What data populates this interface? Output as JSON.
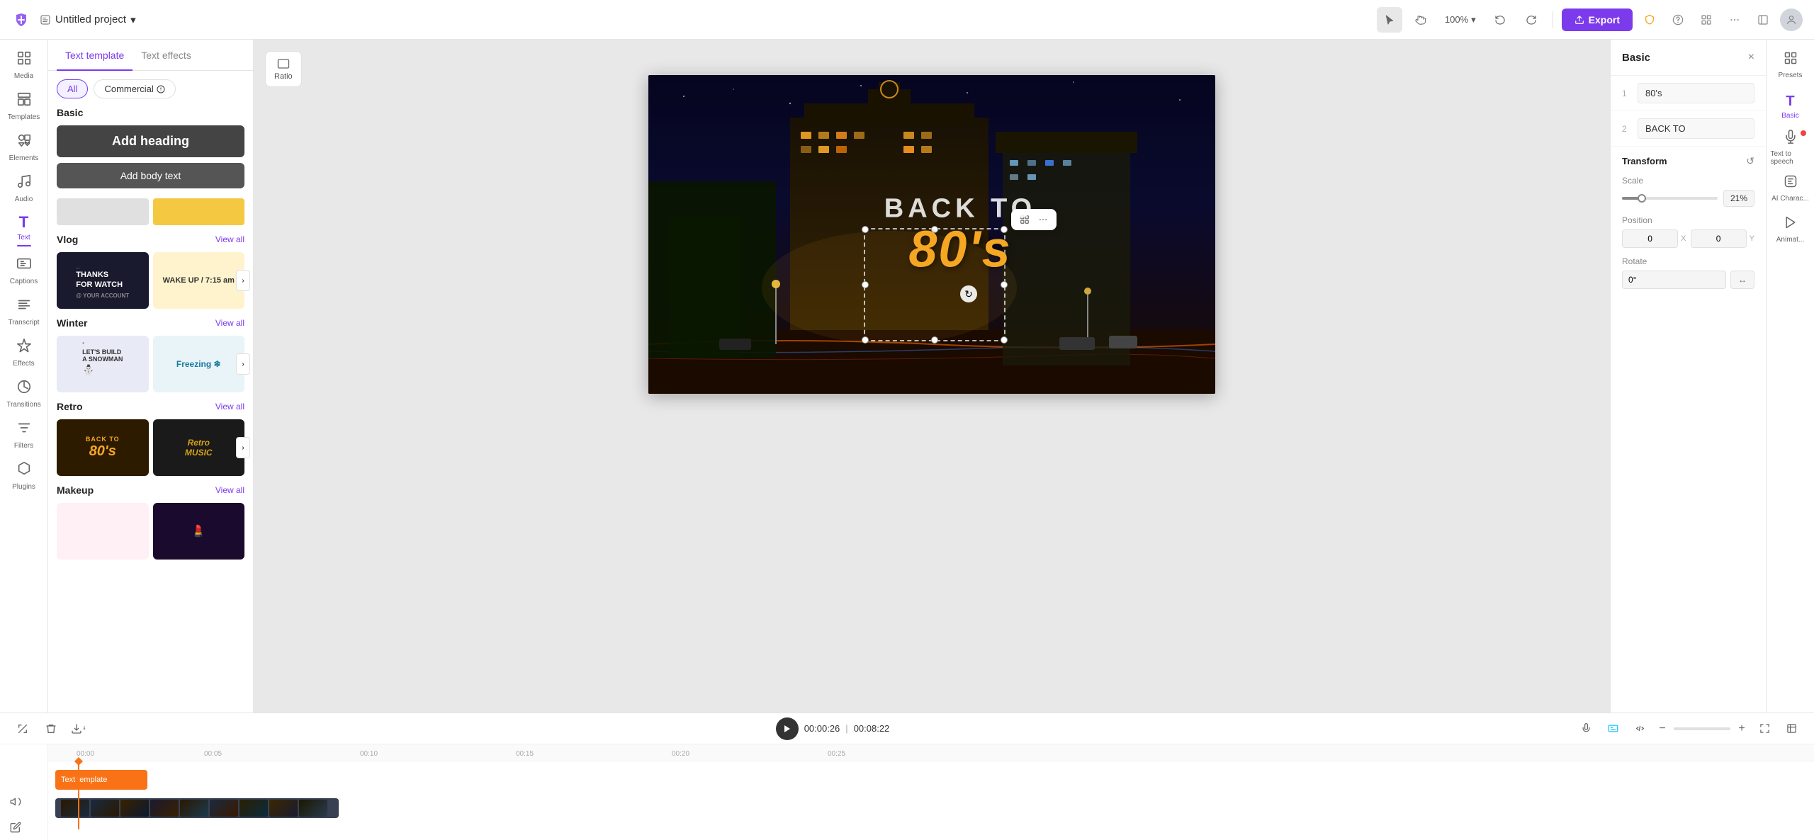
{
  "topbar": {
    "project_name": "Untitled project",
    "zoom_level": "100%",
    "export_label": "Export",
    "undo_icon": "↩",
    "redo_icon": "↪"
  },
  "left_panel": {
    "tab_template": "Text template",
    "tab_effects": "Text effects",
    "filter_all": "All",
    "filter_commercial": "Commercial",
    "add_heading_label": "Add heading",
    "add_body_label": "Add body text",
    "sections": [
      {
        "id": "basic",
        "title": "Basic"
      },
      {
        "id": "vlog",
        "title": "Vlog",
        "view_all": "View all"
      },
      {
        "id": "winter",
        "title": "Winter",
        "view_all": "View all"
      },
      {
        "id": "retro",
        "title": "Retro",
        "view_all": "View all"
      },
      {
        "id": "makeup",
        "title": "Makeup",
        "view_all": "View all"
      }
    ],
    "vlog_cards": [
      {
        "text": "THANKS FOR WATCH",
        "sub": "@ Your account"
      },
      {
        "text": "WAKE UP / 7:15 am"
      }
    ],
    "winter_cards": [
      {
        "text": "LET'S BUILD A SNOWMAN"
      },
      {
        "text": "Freezing ❄"
      }
    ],
    "retro_cards": [
      {
        "text": "BACK TO 80's"
      },
      {
        "text": "Retro MUSIC"
      }
    ]
  },
  "canvas": {
    "text_back_to": "BACK TO",
    "text_80s": "80's"
  },
  "ratio_btn": {
    "icon": "⬜",
    "label": "Ratio"
  },
  "right_panel": {
    "title": "Basic",
    "close_icon": "×",
    "text_rows": [
      {
        "num": "1",
        "value": "80's"
      },
      {
        "num": "2",
        "value": "BACK TO"
      }
    ],
    "transform": {
      "title": "Transform",
      "reset_icon": "↺",
      "scale_label": "Scale",
      "scale_value": "21%",
      "position_label": "Position",
      "pos_x": "0",
      "pos_y": "0",
      "pos_x_label": "X",
      "pos_y_label": "Y",
      "rotate_label": "Rotate",
      "rotate_value": "0°",
      "rotate_icon": "↔"
    }
  },
  "right_sidebar": {
    "items": [
      {
        "id": "presets",
        "icon": "⊞",
        "label": "Presets"
      },
      {
        "id": "basic",
        "icon": "T",
        "label": "Basic"
      },
      {
        "id": "tts",
        "icon": "🔊",
        "label": "Text to speech"
      },
      {
        "id": "ai",
        "icon": "✦",
        "label": "AI Charac..."
      },
      {
        "id": "animate",
        "icon": "▷",
        "label": "Animat..."
      }
    ]
  },
  "nav_sidebar": {
    "items": [
      {
        "id": "media",
        "icon": "⊞",
        "label": "Media"
      },
      {
        "id": "templates",
        "icon": "⊟",
        "label": "Templates"
      },
      {
        "id": "elements",
        "icon": "◈",
        "label": "Elements"
      },
      {
        "id": "audio",
        "icon": "♪",
        "label": "Audio"
      },
      {
        "id": "text",
        "icon": "T",
        "label": "Text",
        "active": true
      },
      {
        "id": "captions",
        "icon": "◻",
        "label": "Captions"
      },
      {
        "id": "transcript",
        "icon": "≡",
        "label": "Transcript"
      },
      {
        "id": "effects",
        "icon": "✦",
        "label": "Effects"
      },
      {
        "id": "transitions",
        "icon": "⊘",
        "label": "Transitions"
      },
      {
        "id": "filters",
        "icon": "◑",
        "label": "Filters"
      },
      {
        "id": "plugins",
        "icon": "⬡",
        "label": "Plugins"
      }
    ]
  },
  "timeline": {
    "current_time": "00:00:26",
    "total_time": "00:08:22",
    "text_clip_label": "Text template",
    "ruler_marks": [
      "00:00",
      "00:05",
      "00:10",
      "00:15",
      "00:20",
      "00:25"
    ],
    "tools": {
      "trim": "⌶",
      "delete": "🗑",
      "download": "⬇",
      "mic": "🎙",
      "caption": "CC",
      "code": "</>",
      "minus": "−",
      "plus": "+",
      "expand": "⤢",
      "fullscreen": "⛶"
    }
  }
}
